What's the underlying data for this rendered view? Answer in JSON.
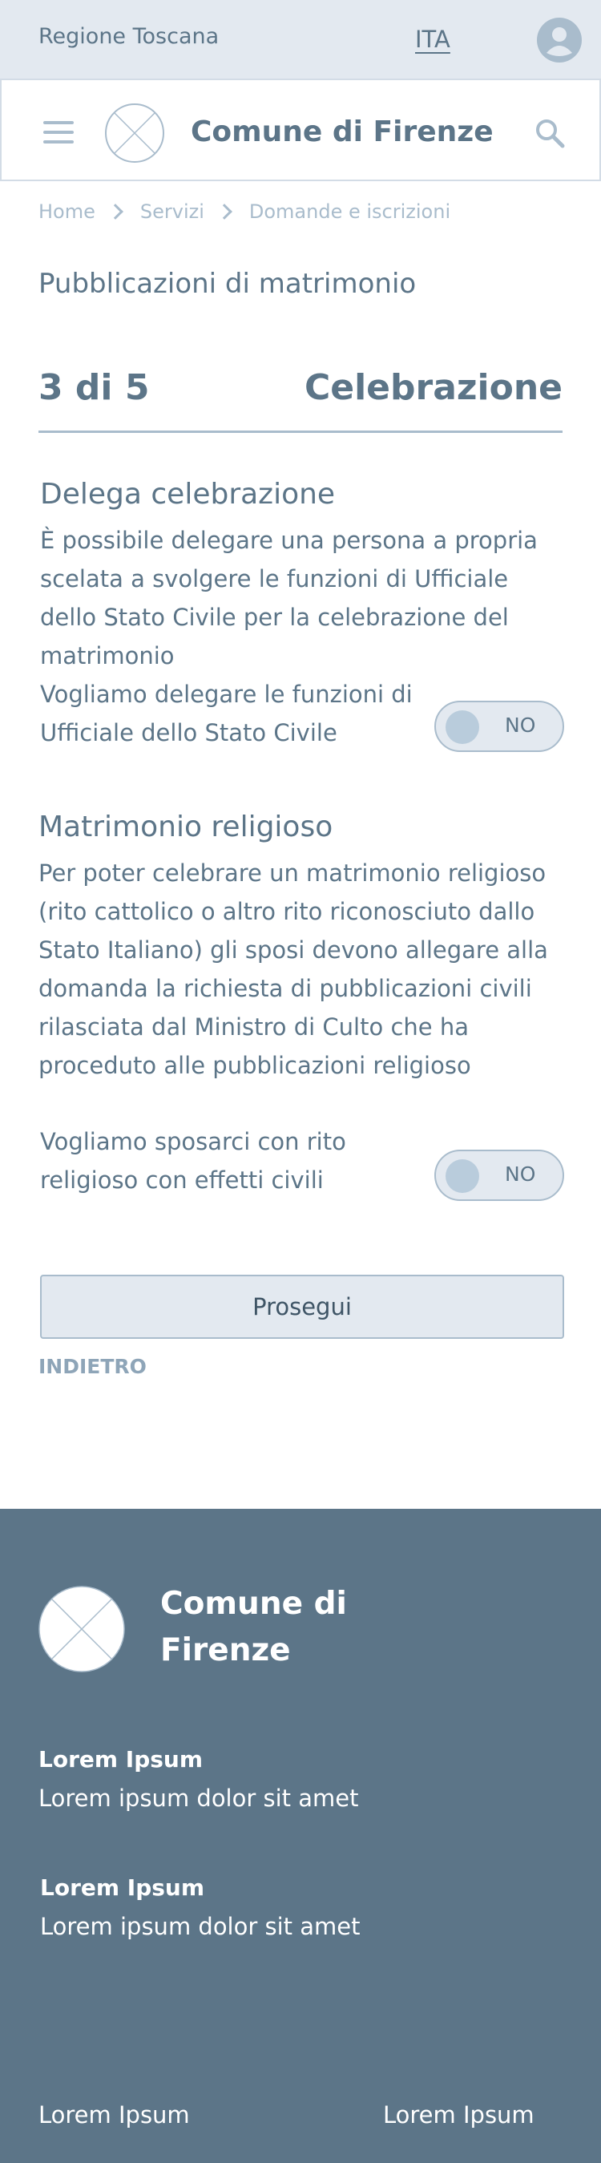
{
  "topbar": {
    "region": "Regione Toscana",
    "language": "ITA"
  },
  "header": {
    "brand": "Comune di Firenze"
  },
  "breadcrumb": [
    "Home",
    "Servizi",
    "Domande e iscrizioni"
  ],
  "page": {
    "title": "Pubblicazioni di matrimonio"
  },
  "stepper": {
    "current": "3 di 5",
    "name": "Celebrazione"
  },
  "sections": [
    {
      "title": "Delega celebrazione",
      "text": "È possibile delegare una persona a propria scelata a svolgere le funzioni di Ufficiale dello Stato Civile per la celebrazione del matrimonio",
      "question": "Vogliamo delegare le funzioni di Ufficiale dello Stato Civile",
      "toggle": "NO"
    },
    {
      "title": "Matrimonio religioso",
      "text": "Per poter celebrare un matrimonio religioso (rito cattolico o altro rito riconosciuto dallo Stato Italiano) gli sposi devono allegare alla domanda la richiesta di pubblicazioni civili rilasciata dal Ministro di Culto che ha proceduto alle pubblicazioni religioso",
      "question": "Vogliamo sposarci con rito religioso con effetti civili",
      "toggle": "NO"
    }
  ],
  "actions": {
    "primary": "Prosegui",
    "back": "INDIETRO"
  },
  "footer": {
    "brand": "Comune di Firenze",
    "blocks": [
      {
        "heading": "Lorem Ipsum",
        "text": "Lorem ipsum dolor sit amet"
      },
      {
        "heading": "Lorem Ipsum",
        "text": "Lorem ipsum dolor sit amet"
      }
    ],
    "links": [
      "Lorem Ipsum",
      "Lorem Ipsum"
    ]
  },
  "colors": {
    "accent": "#5c7588",
    "light": "#e3e9f0",
    "muted": "#a9bccc",
    "footer_bg": "#5c7588"
  },
  "icons": [
    "user-icon",
    "menu-icon",
    "logo-placeholder-icon",
    "search-icon",
    "chevron-right-icon"
  ]
}
